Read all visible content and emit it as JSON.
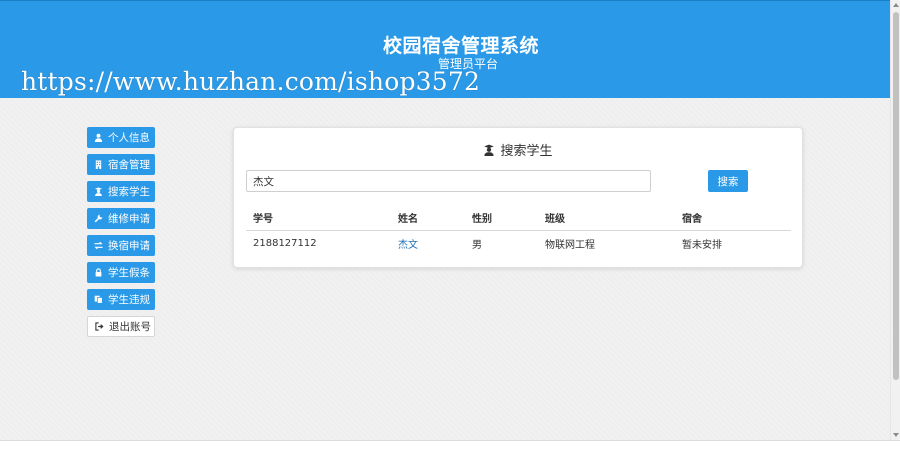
{
  "header": {
    "title": "校园宿舍管理系统",
    "subtitle": "管理员平台",
    "watermark": "https://www.huzhan.com/ishop3572",
    "background": "#2a9ae8"
  },
  "sidebar": {
    "items": [
      {
        "label": "个人信息",
        "icon": "user-icon"
      },
      {
        "label": "宿舍管理",
        "icon": "building-icon"
      },
      {
        "label": "搜索学生",
        "icon": "student-icon"
      },
      {
        "label": "维修申请",
        "icon": "wrench-icon"
      },
      {
        "label": "换宿申请",
        "icon": "exchange-icon"
      },
      {
        "label": "学生假条",
        "icon": "lock-icon"
      },
      {
        "label": "学生违规",
        "icon": "copy-icon"
      }
    ],
    "logout": {
      "label": "退出账号",
      "icon": "sign-out-icon"
    }
  },
  "panel": {
    "title": "搜索学生",
    "title_icon": "student-icon",
    "search": {
      "value": "杰文",
      "placeholder": ""
    },
    "search_button": "搜索",
    "table": {
      "columns": [
        "学号",
        "姓名",
        "性别",
        "班级",
        "宿舍"
      ],
      "rows": [
        [
          "2188127112",
          "杰文",
          "男",
          "物联网工程",
          "暂未安排"
        ]
      ]
    }
  },
  "colors": {
    "accent": "#2a9ae8",
    "link": "#1f6fb5",
    "page_bg": "#f1f1f1"
  }
}
